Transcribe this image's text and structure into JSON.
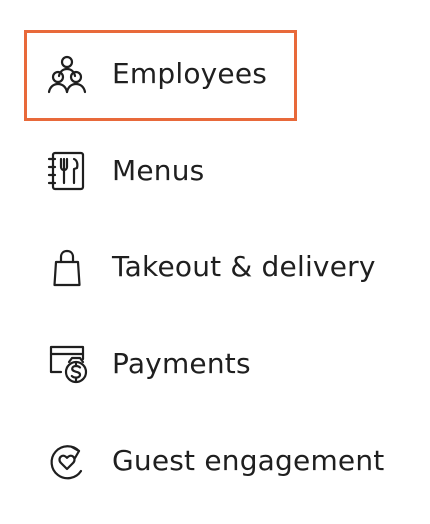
{
  "nav": {
    "selected_index": 0,
    "highlight_color": "#e8693a",
    "items": [
      {
        "label": "Employees",
        "icon": "people-group-icon"
      },
      {
        "label": "Menus",
        "icon": "menu-book-utensils-icon"
      },
      {
        "label": "Takeout & delivery",
        "icon": "shopping-bag-icon"
      },
      {
        "label": "Payments",
        "icon": "payment-card-dollar-icon"
      },
      {
        "label": "Guest engagement",
        "icon": "heart-loop-icon"
      }
    ]
  }
}
